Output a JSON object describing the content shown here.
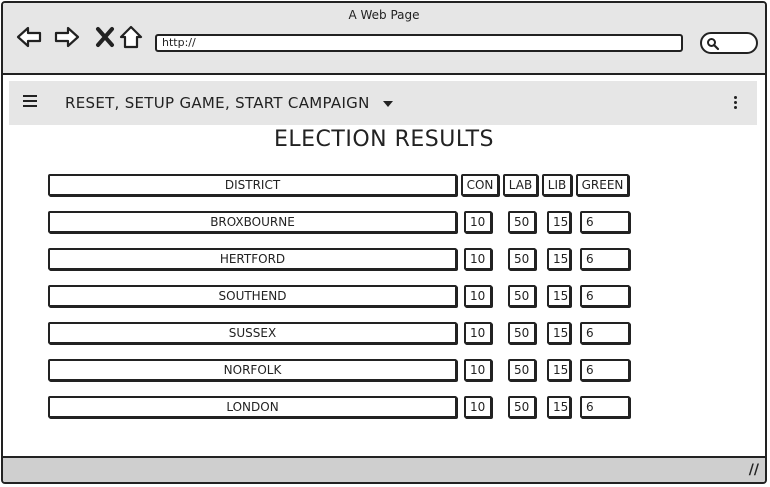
{
  "window": {
    "title": "A Web Page"
  },
  "browser": {
    "url": "http://"
  },
  "menu": {
    "label": "RESET, SETUP GAME, START CAMPAIGN"
  },
  "page": {
    "title": "ELECTION RESULTS"
  },
  "table": {
    "headers": {
      "district": "DISTRICT",
      "con": "CON",
      "lab": "LAB",
      "lib": "LIB",
      "green": "GREEN"
    },
    "rows": [
      {
        "district": "BROXBOURNE",
        "con": "10",
        "lab": "50",
        "lib": "15",
        "green": "6"
      },
      {
        "district": "HERTFORD",
        "con": "10",
        "lab": "50",
        "lib": "15",
        "green": "6"
      },
      {
        "district": "SOUTHEND",
        "con": "10",
        "lab": "50",
        "lib": "15",
        "green": "6"
      },
      {
        "district": "SUSSEX",
        "con": "10",
        "lab": "50",
        "lib": "15",
        "green": "6"
      },
      {
        "district": "NORFOLK",
        "con": "10",
        "lab": "50",
        "lib": "15",
        "green": "6"
      },
      {
        "district": "LONDON",
        "con": "10",
        "lab": "50",
        "lib": "15",
        "green": "6"
      }
    ]
  }
}
